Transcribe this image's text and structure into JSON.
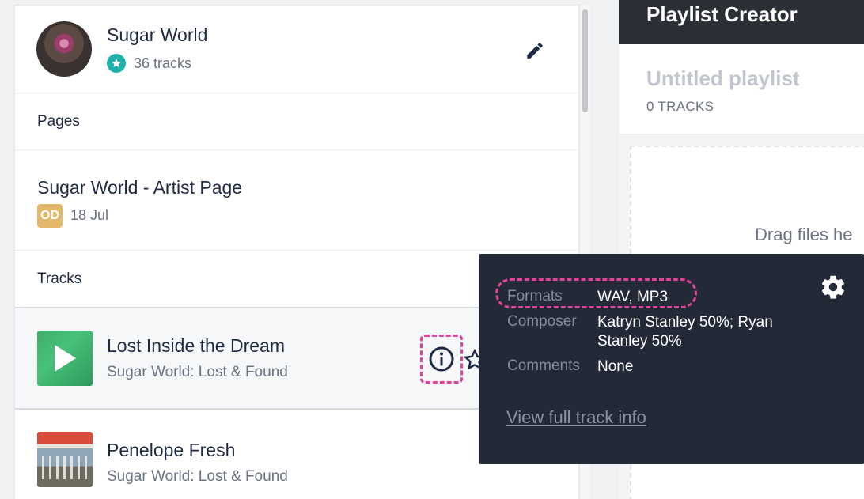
{
  "artist": {
    "name": "Sugar World",
    "track_count": "36 tracks",
    "badge_icon": "star-icon",
    "edit_icon": "pencil-icon"
  },
  "sections": {
    "pages_label": "Pages",
    "tracks_label": "Tracks"
  },
  "page_item": {
    "title": "Sugar World - Artist Page",
    "badge": "OD",
    "date": "18 Jul"
  },
  "tracks": [
    {
      "title": "Lost Inside the Dream",
      "album": "Sugar World: Lost & Found"
    },
    {
      "title": "Penelope Fresh",
      "album": "Sugar World: Lost & Found"
    }
  ],
  "tooltip": {
    "formats_key": "Formats",
    "formats_value": "WAV, MP3",
    "composer_key": "Composer",
    "composer_value": "Katryn Stanley 50%; Ryan Stanley 50%",
    "comments_key": "Comments",
    "comments_value": "None",
    "link": "View full track info"
  },
  "playlist_creator": {
    "header": "Playlist Creator",
    "playlist_name": "Untitled playlist",
    "track_count": "0 TRACKS",
    "drop_text": "Drag files he"
  },
  "colors": {
    "accent_teal": "#20b2aa",
    "highlight_pink": "#e0439a",
    "tooltip_bg": "#232936",
    "header_dark": "#2b2f35"
  }
}
